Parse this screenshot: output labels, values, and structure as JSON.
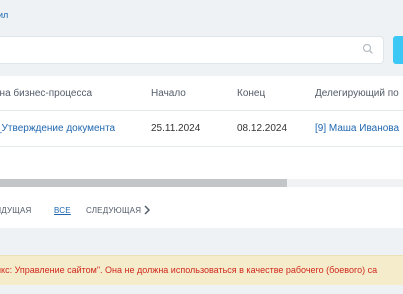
{
  "top_link": {
    "label": "ил"
  },
  "filter": {
    "value": ""
  },
  "grid": {
    "columns": [
      "она бизнес-процесса",
      "Начало",
      "Конец",
      "Делегирующий по"
    ],
    "rows": [
      {
        "name": "_Утверждение документа",
        "start": "25.11.2024",
        "end": "08.12.2024",
        "delegator": "[9] Маша Иванова"
      }
    ]
  },
  "pagination": {
    "prev_label": "ЫДУЩАЯ",
    "all_label": "ВСЕ",
    "next_label": "СЛЕДУЮЩАЯ"
  },
  "warning": {
    "text": "икс: Управление сайтом\". Она не должна использоваться в качестве рабочего (боевого) са"
  },
  "icons": {
    "search": "search-icon",
    "next": "chevron-right-icon"
  },
  "colors": {
    "accent": "#3bc8f5",
    "link": "#2067b0",
    "warning_text": "#d0271c",
    "warning_bg": "#f5eccb"
  }
}
